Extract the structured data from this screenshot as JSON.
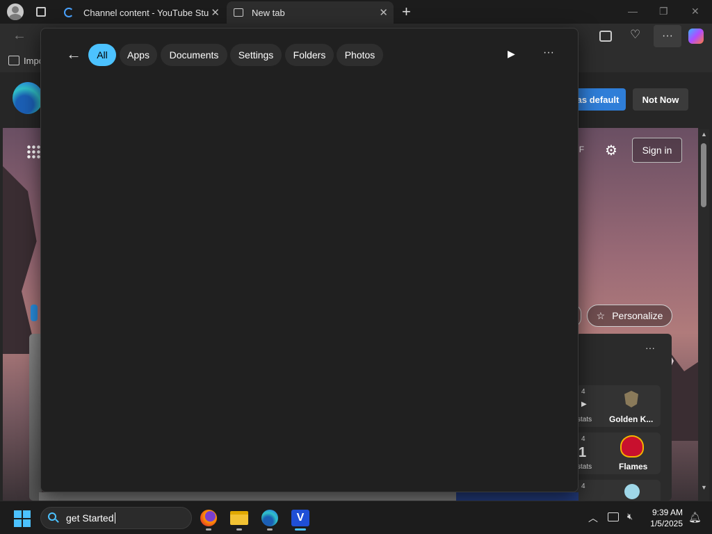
{
  "browser": {
    "tabs": [
      {
        "title": "Channel content - YouTube Studio",
        "close": "✕"
      },
      {
        "title": "New tab",
        "close": "✕"
      }
    ],
    "new_tab": "+",
    "favorites_label": "Impo"
  },
  "banner": {
    "set_default_label": "as default",
    "not_now_label": "Not Now"
  },
  "ntp": {
    "weather": "°F",
    "sign_in_label": "Sign in",
    "personalize_label": "Personalize",
    "more_label": "···",
    "scores": [
      {
        "period": "4",
        "team": "Golden K...",
        "score": "",
        "link": "stats"
      },
      {
        "period": "4",
        "team": "Flames",
        "score": "1",
        "link": "stats"
      },
      {
        "period": "4",
        "team": "",
        "score": "",
        "link": ""
      }
    ]
  },
  "search_flyout": {
    "filters": [
      {
        "label": "All",
        "active": true
      },
      {
        "label": "Apps",
        "active": false
      },
      {
        "label": "Documents",
        "active": false
      },
      {
        "label": "Settings",
        "active": false
      },
      {
        "label": "Folders",
        "active": false
      },
      {
        "label": "Photos",
        "active": false
      }
    ],
    "more_label": "···"
  },
  "taskbar": {
    "search_value": "get Started",
    "time": "9:39 AM",
    "date": "1/5/2025"
  },
  "colors": {
    "accent": "#4cc2ff",
    "edge_blue": "#2f7ed8",
    "flames_red": "#c8102e"
  }
}
